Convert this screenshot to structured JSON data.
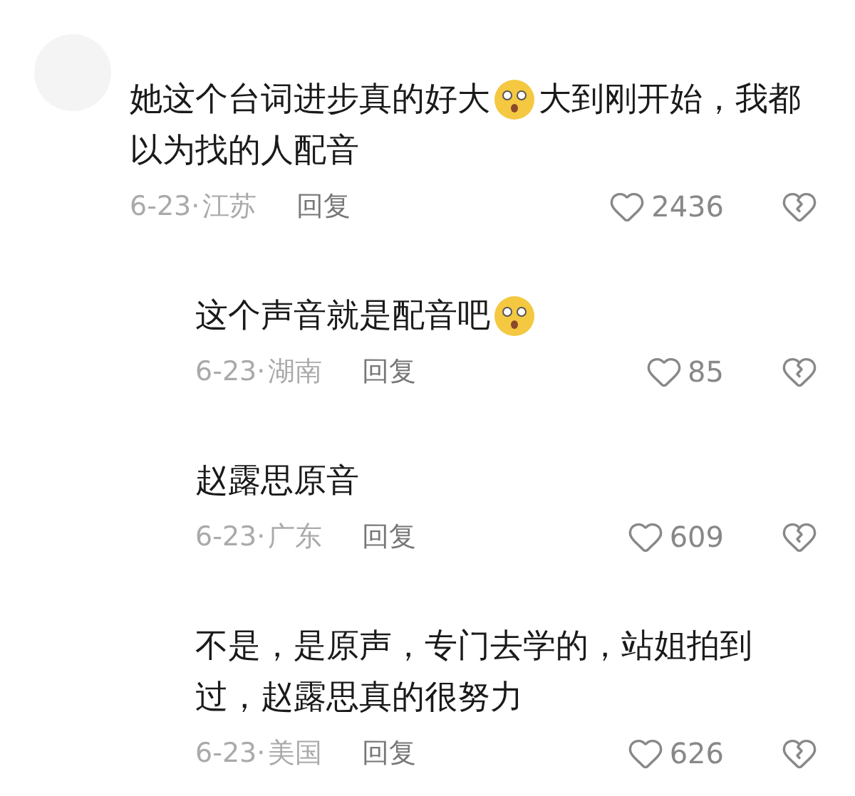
{
  "comments": [
    {
      "lines": [
        [
          {
            "kind": "text",
            "text": "她这个台词进步真的好大"
          },
          {
            "kind": "emoji"
          },
          {
            "kind": "text",
            "text": "大到刚开始，我都"
          }
        ],
        [
          {
            "kind": "text",
            "text": "以为找的人配音"
          }
        ]
      ],
      "date": "6-23·",
      "region": "江苏",
      "reply": "回复",
      "likes": "2436",
      "children": [
        {
          "lines": [
            [
              {
                "kind": "text",
                "text": "这个声音就是配音吧"
              },
              {
                "kind": "emoji"
              }
            ]
          ],
          "date": "6-23·",
          "region": "湖南",
          "reply": "回复",
          "likes": "85"
        },
        {
          "lines": [
            [
              {
                "kind": "text",
                "text": "赵露思原音"
              }
            ]
          ],
          "date": "6-23·",
          "region": "广东",
          "reply": "回复",
          "likes": "609"
        },
        {
          "lines": [
            [
              {
                "kind": "text",
                "text": "不是，是原声，专门去学的，站姐拍到"
              }
            ],
            [
              {
                "kind": "text",
                "text": "过，赵露思真的很努力"
              }
            ]
          ],
          "date": "6-23·",
          "region": "美国",
          "reply": "回复",
          "likes": "626"
        }
      ]
    }
  ]
}
